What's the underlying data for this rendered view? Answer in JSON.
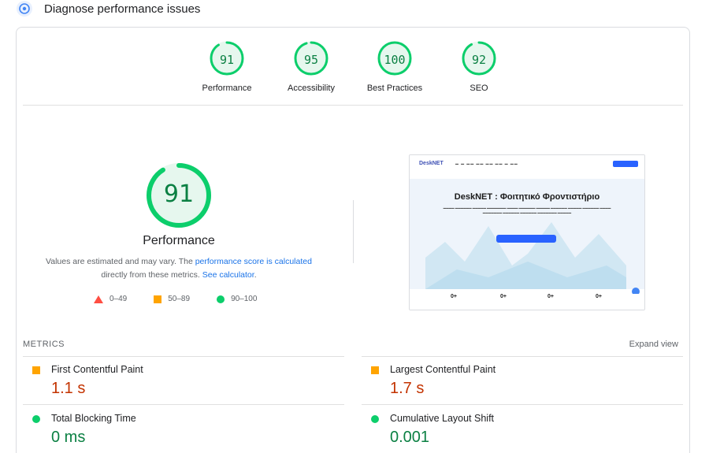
{
  "header": {
    "title": "Diagnose performance issues",
    "icon": "speedometer-icon"
  },
  "categories": [
    {
      "label": "Performance",
      "score": "91",
      "value": 91
    },
    {
      "label": "Accessibility",
      "score": "95",
      "value": 95
    },
    {
      "label": "Best Practices",
      "score": "100",
      "value": 100
    },
    {
      "label": "SEO",
      "score": "92",
      "value": 92
    }
  ],
  "performance": {
    "score": "91",
    "value": 91,
    "title": "Performance",
    "desc_1": "Values are estimated and may vary. The ",
    "desc_link_1": "performance score is calculated",
    "desc_2": " directly from these metrics. ",
    "desc_link_2": "See calculator",
    "desc_3": "."
  },
  "legend": {
    "fail": "0–49",
    "average": "50–89",
    "pass": "90–100"
  },
  "screenshot": {
    "logo": "DeskNET",
    "title": "DeskNET : Φοιτητικό Φροντιστήριο",
    "stats": [
      "0+",
      "0+",
      "0+",
      "0+"
    ]
  },
  "metrics": {
    "label": "METRICS",
    "expand": "Expand view",
    "items": [
      {
        "name": "First Contentful Paint",
        "value": "1.1 s",
        "status": "average"
      },
      {
        "name": "Largest Contentful Paint",
        "value": "1.7 s",
        "status": "average"
      },
      {
        "name": "Total Blocking Time",
        "value": "0 ms",
        "status": "pass"
      },
      {
        "name": "Cumulative Layout Shift",
        "value": "0.001",
        "status": "pass"
      }
    ]
  },
  "colors": {
    "pass": "#0cce6b",
    "pass_text": "#0b8043",
    "average": "#ffa400",
    "average_text": "#c33300",
    "fail": "#ff4e42",
    "link": "#1a73e8"
  }
}
